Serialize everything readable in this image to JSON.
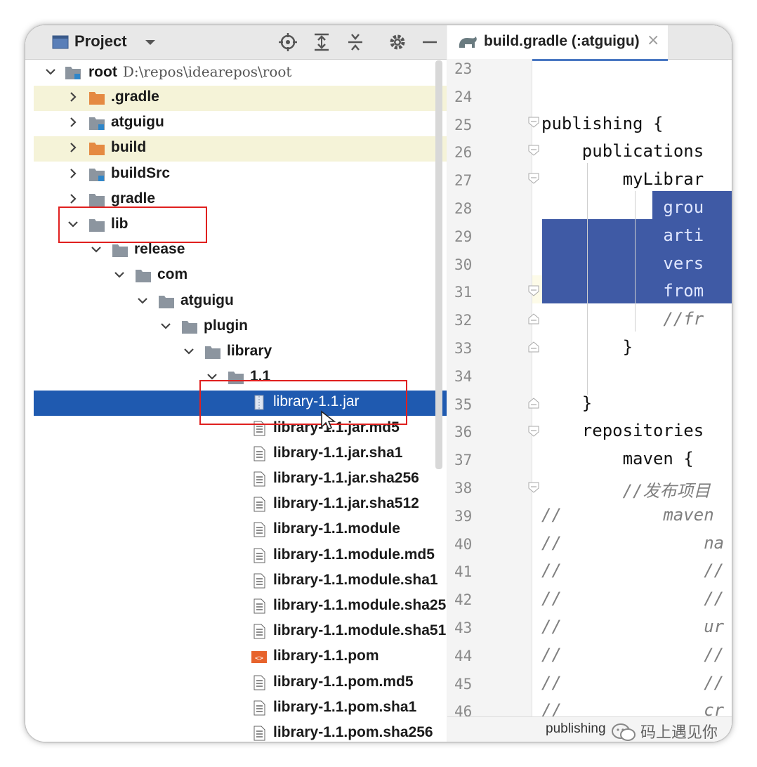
{
  "project_panel": {
    "title": "Project",
    "root": {
      "name": "root",
      "path": "D:\\repos\\idearepos\\root"
    },
    "items": [
      {
        "label": ".gradle",
        "depth": 1,
        "icon": "folder-orange-icon",
        "expanded": false
      },
      {
        "label": "atguigu",
        "depth": 1,
        "icon": "module-folder-icon",
        "expanded": false
      },
      {
        "label": "build",
        "depth": 1,
        "icon": "folder-orange-icon",
        "expanded": false
      },
      {
        "label": "buildSrc",
        "depth": 1,
        "icon": "module-folder-icon",
        "expanded": false
      },
      {
        "label": "gradle",
        "depth": 1,
        "icon": "folder-icon",
        "expanded": false
      },
      {
        "label": "lib",
        "depth": 1,
        "icon": "folder-icon",
        "expanded": true
      },
      {
        "label": "release",
        "depth": 2,
        "icon": "folder-icon",
        "expanded": true
      },
      {
        "label": "com",
        "depth": 3,
        "icon": "folder-icon",
        "expanded": true
      },
      {
        "label": "atguigu",
        "depth": 4,
        "icon": "folder-icon",
        "expanded": true
      },
      {
        "label": "plugin",
        "depth": 5,
        "icon": "folder-icon",
        "expanded": true
      },
      {
        "label": "library",
        "depth": 6,
        "icon": "folder-icon",
        "expanded": true
      },
      {
        "label": "1.1",
        "depth": 7,
        "icon": "folder-icon",
        "expanded": true
      },
      {
        "label": "library-1.1.jar",
        "depth": 8,
        "icon": "jar-icon"
      },
      {
        "label": "library-1.1.jar.md5",
        "depth": 8,
        "icon": "file-icon"
      },
      {
        "label": "library-1.1.jar.sha1",
        "depth": 8,
        "icon": "file-icon"
      },
      {
        "label": "library-1.1.jar.sha256",
        "depth": 8,
        "icon": "file-icon"
      },
      {
        "label": "library-1.1.jar.sha512",
        "depth": 8,
        "icon": "file-icon"
      },
      {
        "label": "library-1.1.module",
        "depth": 8,
        "icon": "file-icon"
      },
      {
        "label": "library-1.1.module.md5",
        "depth": 8,
        "icon": "file-icon"
      },
      {
        "label": "library-1.1.module.sha1",
        "depth": 8,
        "icon": "file-icon"
      },
      {
        "label": "library-1.1.module.sha25",
        "depth": 8,
        "icon": "file-icon"
      },
      {
        "label": "library-1.1.module.sha51",
        "depth": 8,
        "icon": "file-icon"
      },
      {
        "label": "library-1.1.pom",
        "depth": 8,
        "icon": "pom-icon"
      },
      {
        "label": "library-1.1.pom.md5",
        "depth": 8,
        "icon": "file-icon"
      },
      {
        "label": "library-1.1.pom.sha1",
        "depth": 8,
        "icon": "file-icon"
      },
      {
        "label": "library-1.1.pom.sha256",
        "depth": 8,
        "icon": "file-icon"
      }
    ]
  },
  "editor": {
    "tab_label": "build.gradle (:atguigu)",
    "tab_close": "×",
    "line_numbers": [
      "23",
      "24",
      "25",
      "26",
      "27",
      "28",
      "29",
      "30",
      "31",
      "32",
      "33",
      "34",
      "35",
      "36",
      "37",
      "38",
      "39",
      "40",
      "41",
      "42",
      "43",
      "44",
      "45",
      "46"
    ],
    "code_lines": [
      "",
      "",
      "publishing {",
      "    publications",
      "        myLibrar",
      "            grou",
      "            arti",
      "            vers",
      "            from",
      "            //fr",
      "        }",
      "",
      "    }",
      "    repositories",
      "        maven {",
      "        //发布项目",
      "//          maven",
      "//              na",
      "//              //",
      "//              //",
      "//              ur",
      "//              //",
      "//              //",
      "//              cr"
    ],
    "status_text": "publishing",
    "colors": {
      "selection": "#3f5aa5",
      "current_line": "#fdfbe8"
    }
  },
  "watermark": "码上遇见你"
}
